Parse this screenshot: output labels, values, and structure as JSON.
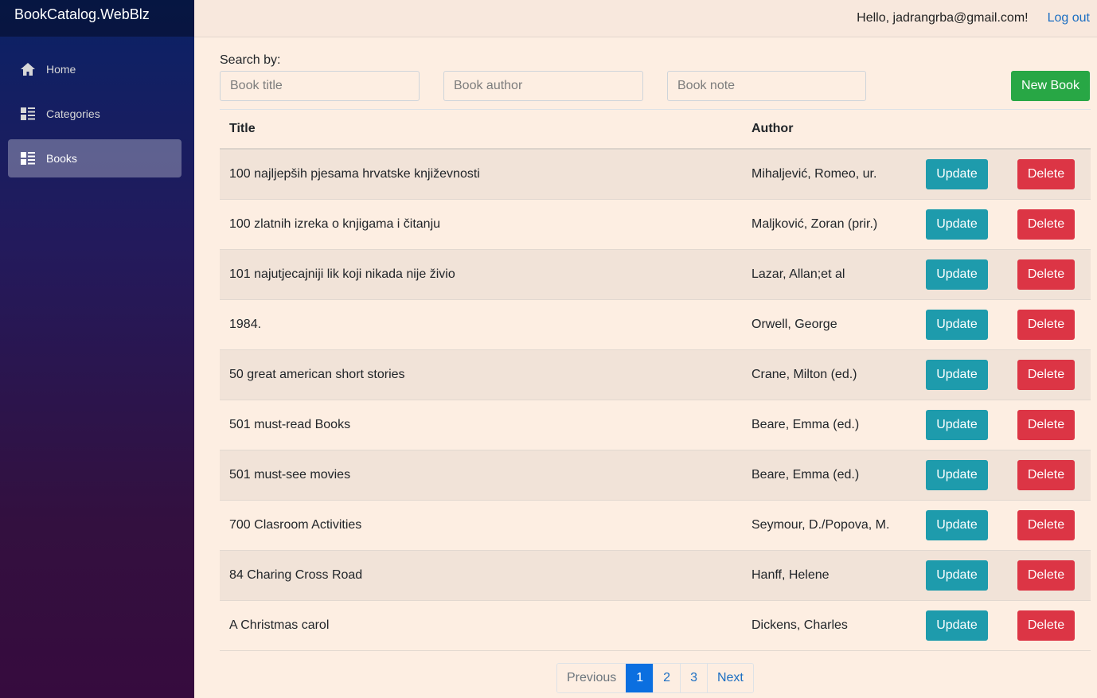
{
  "app": {
    "brand": "BookCatalog.WebBlz"
  },
  "sidebar": {
    "items": [
      {
        "label": "Home",
        "icon": "home-icon",
        "active": false
      },
      {
        "label": "Categories",
        "icon": "list-icon",
        "active": false
      },
      {
        "label": "Books",
        "icon": "list-icon",
        "active": true
      }
    ]
  },
  "topbar": {
    "greeting": "Hello, jadrangrba@gmail.com!",
    "logout_label": "Log out"
  },
  "search": {
    "label": "Search by:",
    "title_placeholder": "Book title",
    "author_placeholder": "Book author",
    "note_placeholder": "Book note",
    "title_value": "",
    "author_value": "",
    "note_value": ""
  },
  "toolbar": {
    "new_book_label": "New Book"
  },
  "table": {
    "headers": {
      "title": "Title",
      "author": "Author"
    },
    "update_label": "Update",
    "delete_label": "Delete",
    "rows": [
      {
        "title": "100 najljepših pjesama hrvatske književnosti",
        "author": "Mihaljević, Romeo, ur."
      },
      {
        "title": "100 zlatnih izreka o knjigama i čitanju",
        "author": "Maljković, Zoran (prir.)"
      },
      {
        "title": "101 najutjecajniji lik koji nikada nije živio",
        "author": "Lazar, Allan;et al"
      },
      {
        "title": "1984.",
        "author": "Orwell, George"
      },
      {
        "title": "50 great american short stories",
        "author": "Crane, Milton (ed.)"
      },
      {
        "title": "501 must-read Books",
        "author": "Beare, Emma (ed.)"
      },
      {
        "title": "501 must-see movies",
        "author": "Beare, Emma (ed.)"
      },
      {
        "title": "700 Clasroom Activities",
        "author": "Seymour, D./Popova, M."
      },
      {
        "title": "84 Charing Cross Road",
        "author": "Hanff, Helene"
      },
      {
        "title": "A Christmas carol",
        "author": "Dickens, Charles"
      }
    ]
  },
  "pagination": {
    "previous_label": "Previous",
    "pages": [
      "1",
      "2",
      "3"
    ],
    "current_page": "1",
    "next_label": "Next"
  },
  "colors": {
    "sidebar_top": "#0a2266",
    "sidebar_bottom": "#360b3e",
    "content_bg": "#fdeee2",
    "new_book": "#28a745",
    "update": "#1e9bac",
    "delete": "#dc3545",
    "link": "#1b6ec2",
    "active_page": "#0b6fe0"
  }
}
